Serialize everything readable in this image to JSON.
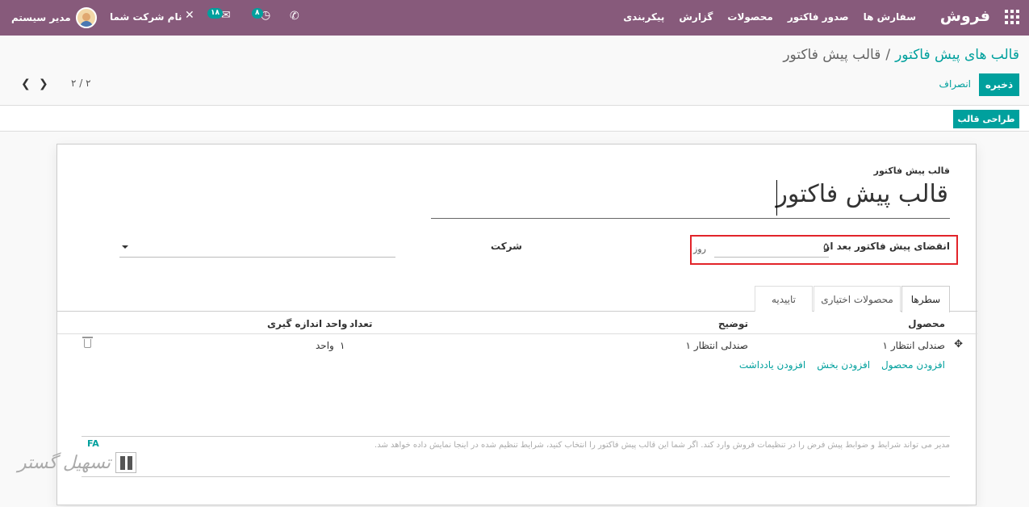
{
  "navbar": {
    "brand": "فروش",
    "menu": [
      "سفارش ها",
      "صدور فاکتور",
      "محصولات",
      "گزارش",
      "پیکربندی"
    ],
    "company": "نام شرکت شما",
    "user": "مدیر سیستم",
    "messages_badge": "۱۸",
    "activities_badge": "۸"
  },
  "breadcrumb": {
    "parent": "قالب های پیش فاکتور",
    "separator": "/",
    "current": "قالب پیش فاکتور"
  },
  "toolbar": {
    "save_label": "ذخیره",
    "discard_label": "انصراف",
    "pager": "۲ / ۲",
    "design_label": "طراحی قالب"
  },
  "form": {
    "name_label": "قالب پیش فاکتور",
    "name_value": "قالب پیش فاکتور",
    "expiry_label": "انقضای پیش فاکتور بعد از",
    "expiry_value": "۵",
    "expiry_unit": "روز",
    "company_label": "شرکت",
    "company_value": ""
  },
  "tabs": [
    {
      "label": "سطرها",
      "active": true
    },
    {
      "label": "محصولات اختیاری",
      "active": false
    },
    {
      "label": "تاییدیه",
      "active": false
    }
  ],
  "lines_table": {
    "headers": {
      "product": "محصول",
      "description": "توضیح",
      "quantity": "تعداد",
      "uom": "واحد اندازه گیری"
    },
    "rows": [
      {
        "product": "صندلی انتظار ۱",
        "description": "صندلی انتظار ۱",
        "quantity": "۱",
        "uom": "واحد"
      }
    ],
    "add_links": [
      "افزودن محصول",
      "افزودن بخش",
      "افزودن یادداشت"
    ]
  },
  "terms_note": {
    "placeholder": "مدیر می تواند شرایط و ضوابط پیش فرض را در تنظیمات فروش وارد کند. اگر شما این قالب پیش فاکتور را انتخاب کنید، شرایط تنظیم شده در اینجا نمایش داده خواهد شد.",
    "lang": "FA"
  },
  "colors": {
    "navbar": "#875a7b",
    "accent": "#00a09d",
    "highlight": "#e2242a"
  }
}
